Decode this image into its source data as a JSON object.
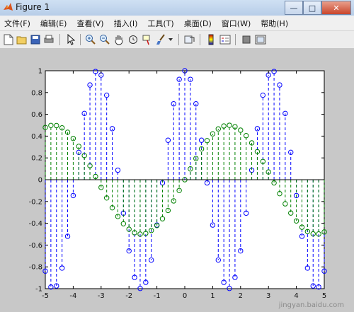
{
  "window": {
    "title": "Figure 1",
    "buttons": {
      "minimize": "—",
      "maximize": "□",
      "close": "✕"
    }
  },
  "menu": {
    "items": [
      "文件(F)",
      "编辑(E)",
      "查看(V)",
      "插入(I)",
      "工具(T)",
      "桌面(D)",
      "窗口(W)",
      "帮助(H)"
    ]
  },
  "toolbar": {
    "icons": [
      "new-figure-icon",
      "open-file-icon",
      "save-icon",
      "print-icon",
      "pointer-icon",
      "zoom-in-icon",
      "zoom-out-icon",
      "pan-hand-icon",
      "rotate-3d-icon",
      "data-cursor-icon",
      "brush-icon",
      "brush-dropdown-icon",
      "link-plot-icon",
      "insert-colorbar-icon",
      "insert-legend-icon",
      "hide-plot-tools-icon",
      "show-plot-tools-icon"
    ]
  },
  "colors": {
    "series1": "#0000ff",
    "series2": "#008000",
    "stem_baseline": "#000000"
  },
  "chart_data": {
    "type": "stem",
    "title": "",
    "xlabel": "",
    "ylabel": "",
    "xlim": [
      -5,
      5
    ],
    "ylim": [
      -1,
      1
    ],
    "xticks": [
      "-5",
      "-4",
      "-3",
      "-2",
      "-1",
      "0",
      "1",
      "2",
      "3",
      "4",
      "5"
    ],
    "yticks": [
      "-1",
      "-0.8",
      "-0.6",
      "-0.4",
      "-0.2",
      "0",
      "0.2",
      "0.4",
      "0.6",
      "0.8",
      "1"
    ],
    "grid": false,
    "series": [
      {
        "function": "cos(2x)",
        "x_range": [
          -5,
          5
        ],
        "step": 0.2
      },
      {
        "function": "0.5·sin(x)",
        "x_range": [
          -5,
          5
        ],
        "step": 0.2
      }
    ]
  },
  "watermark": "jingyan.baidu.com"
}
